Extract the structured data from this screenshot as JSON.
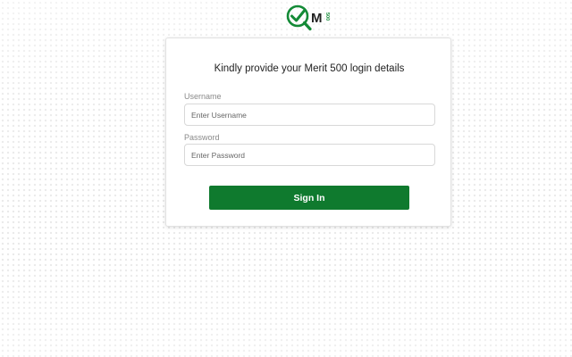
{
  "logo": {
    "letter": "M",
    "number": "500"
  },
  "login": {
    "heading": "Kindly provide your Merit 500 login details",
    "username_label": "Username",
    "username_placeholder": "Enter Username",
    "username_value": "",
    "password_label": "Password",
    "password_placeholder": "Enter Password",
    "password_value": "",
    "sign_in_label": "Sign In"
  },
  "colors": {
    "brand_green": "#0f7a2e",
    "background": "#ffffff"
  }
}
